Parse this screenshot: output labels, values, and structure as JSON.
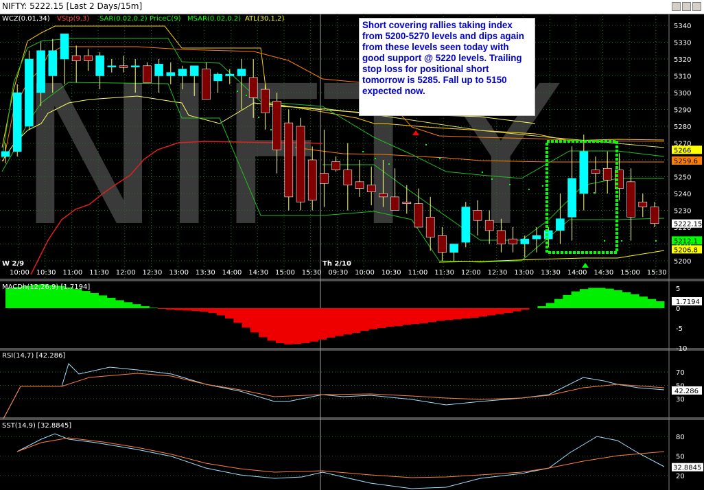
{
  "window": {
    "title": "NIFTY:  5222.15 [Last 2 Days/15m]"
  },
  "watermark": "NIFTY",
  "main_legend": [
    {
      "text": "WCZ(0.01,34)",
      "color": "#ffffff"
    },
    {
      "text": "VStp(9,3)",
      "color": "#ff4040"
    },
    {
      "text": "SAR(0.02,0.2)",
      "color": "#00ff00"
    },
    {
      "text": "PriceC(9)",
      "color": "#00ff00"
    },
    {
      "text": "MSAR(0.02,0.2)",
      "color": "#00ff00"
    },
    {
      "text": "ATL(30,1,2)",
      "color": "#ffff00"
    }
  ],
  "annotation": "Short covering rallies taking index from 5200-5270 levels and dips again from these levels seen today with good support @ 5220 levels. Trailing stop loss for positional short tomorrow is 5285. Fall up to 5150 expected now.",
  "price_axis": [
    "5340",
    "5330",
    "5320",
    "5310",
    "5300",
    "5290",
    "5280",
    "5270",
    "5260",
    "5250",
    "5240",
    "5230",
    "5220",
    "5210",
    "5200"
  ],
  "price_tags": [
    {
      "text": "5266",
      "bg": "#ffff00",
      "fg": "#000000"
    },
    {
      "text": "5259.6",
      "bg": "#ff8000",
      "fg": "#000000"
    },
    {
      "text": "5222.15",
      "bg": "#ffffff",
      "fg": "#000000"
    },
    {
      "text": "5212.1",
      "bg": "#00ff00",
      "fg": "#000000"
    },
    {
      "text": "5206.8",
      "bg": "#ffff00",
      "fg": "#000000"
    }
  ],
  "time_axis": [
    "10:00",
    "10:30",
    "11:00",
    "11:30",
    "12:00",
    "12:30",
    "13:00",
    "13:30",
    "14:00",
    "14:30",
    "15:00",
    "15:30",
    "09:30",
    "10:00",
    "10:30",
    "11:00",
    "11:30",
    "12:00",
    "12:30",
    "13:00",
    "13:30",
    "14:00",
    "14:30",
    "15:00",
    "15:30"
  ],
  "day_labels": [
    {
      "text": "W  2/9"
    },
    {
      "text": "Th 2/10"
    }
  ],
  "macd": {
    "label": "MACDh(12,26,9) [1.7194]",
    "axis": [
      "5",
      "0",
      "-5",
      "-10"
    ],
    "tag": "1.7194"
  },
  "rsi": {
    "label": "RSI(14,7) [42.286]",
    "axis": [
      "70",
      "50",
      "30"
    ],
    "tag": "42.286"
  },
  "sst": {
    "label": "SST(14,9) [32.8845]",
    "axis": [
      "80",
      "50",
      "20"
    ],
    "tag": "32.8845"
  },
  "chart_data": {
    "type": "candlestick",
    "price_ylim": [
      5200,
      5340
    ],
    "candles": [
      {
        "o": 5262,
        "h": 5270,
        "l": 5258,
        "c": 5265
      },
      {
        "o": 5265,
        "h": 5305,
        "l": 5262,
        "c": 5300
      },
      {
        "o": 5280,
        "h": 5325,
        "l": 5278,
        "c": 5320
      },
      {
        "o": 5300,
        "h": 5330,
        "l": 5292,
        "c": 5325
      },
      {
        "o": 5310,
        "h": 5332,
        "l": 5300,
        "c": 5325
      },
      {
        "o": 5320,
        "h": 5335,
        "l": 5305,
        "c": 5335
      },
      {
        "o": 5322,
        "h": 5328,
        "l": 5306,
        "c": 5319
      },
      {
        "o": 5322,
        "h": 5326,
        "l": 5313,
        "c": 5319
      },
      {
        "o": 5310,
        "h": 5324,
        "l": 5302,
        "c": 5322
      },
      {
        "o": 5316,
        "h": 5320,
        "l": 5312,
        "c": 5316
      },
      {
        "o": 5316,
        "h": 5322,
        "l": 5312,
        "c": 5315
      },
      {
        "o": 5316,
        "h": 5320,
        "l": 5300,
        "c": 5316
      },
      {
        "o": 5316,
        "h": 5318,
        "l": 5306,
        "c": 5306
      },
      {
        "o": 5310,
        "h": 5320,
        "l": 5300,
        "c": 5317
      },
      {
        "o": 5310,
        "h": 5318,
        "l": 5305,
        "c": 5312
      },
      {
        "o": 5310,
        "h": 5316,
        "l": 5302,
        "c": 5314
      },
      {
        "o": 5310,
        "h": 5315,
        "l": 5298,
        "c": 5316
      },
      {
        "o": 5314,
        "h": 5318,
        "l": 5296,
        "c": 5296
      },
      {
        "o": 5307,
        "h": 5312,
        "l": 5300,
        "c": 5311
      },
      {
        "o": 5310,
        "h": 5314,
        "l": 5305,
        "c": 5311
      },
      {
        "o": 5310,
        "h": 5320,
        "l": 5290,
        "c": 5314
      },
      {
        "o": 5309,
        "h": 5320,
        "l": 5285,
        "c": 5297
      },
      {
        "o": 5302,
        "h": 5305,
        "l": 5278,
        "c": 5288
      },
      {
        "o": 5295,
        "h": 5300,
        "l": 5252,
        "c": 5266
      },
      {
        "o": 5282,
        "h": 5290,
        "l": 5230,
        "c": 5238
      },
      {
        "o": 5280,
        "h": 5285,
        "l": 5230,
        "c": 5235
      },
      {
        "o": 5260,
        "h": 5268,
        "l": 5230,
        "c": 5236
      },
      {
        "o": 5252,
        "h": 5278,
        "l": 5232,
        "c": 5246
      },
      {
        "o": 5259,
        "h": 5262,
        "l": 5253,
        "c": 5254
      },
      {
        "o": 5254,
        "h": 5270,
        "l": 5230,
        "c": 5245
      },
      {
        "o": 5247,
        "h": 5260,
        "l": 5238,
        "c": 5243
      },
      {
        "o": 5245,
        "h": 5256,
        "l": 5233,
        "c": 5241
      },
      {
        "o": 5240,
        "h": 5260,
        "l": 5232,
        "c": 5238
      },
      {
        "o": 5238,
        "h": 5255,
        "l": 5230,
        "c": 5230
      },
      {
        "o": 5235,
        "h": 5245,
        "l": 5228,
        "c": 5234
      },
      {
        "o": 5234,
        "h": 5243,
        "l": 5220,
        "c": 5220
      },
      {
        "o": 5226,
        "h": 5238,
        "l": 5206,
        "c": 5214
      },
      {
        "o": 5215,
        "h": 5220,
        "l": 5200,
        "c": 5205
      },
      {
        "o": 5205,
        "h": 5210,
        "l": 5200,
        "c": 5210
      },
      {
        "o": 5211,
        "h": 5235,
        "l": 5208,
        "c": 5232
      },
      {
        "o": 5230,
        "h": 5236,
        "l": 5215,
        "c": 5224
      },
      {
        "o": 5224,
        "h": 5230,
        "l": 5210,
        "c": 5218
      },
      {
        "o": 5218,
        "h": 5225,
        "l": 5205,
        "c": 5210
      },
      {
        "o": 5213,
        "h": 5220,
        "l": 5205,
        "c": 5210
      },
      {
        "o": 5210,
        "h": 5215,
        "l": 5202,
        "c": 5213
      },
      {
        "o": 5213,
        "h": 5220,
        "l": 5205,
        "c": 5215
      },
      {
        "o": 5213,
        "h": 5220,
        "l": 5208,
        "c": 5218
      },
      {
        "o": 5218,
        "h": 5240,
        "l": 5210,
        "c": 5225
      },
      {
        "o": 5226,
        "h": 5268,
        "l": 5212,
        "c": 5249
      },
      {
        "o": 5240,
        "h": 5275,
        "l": 5230,
        "c": 5265
      },
      {
        "o": 5254,
        "h": 5262,
        "l": 5240,
        "c": 5252
      },
      {
        "o": 5255,
        "h": 5265,
        "l": 5240,
        "c": 5248
      },
      {
        "o": 5254,
        "h": 5264,
        "l": 5236,
        "c": 5243
      },
      {
        "o": 5247,
        "h": 5255,
        "l": 5212,
        "c": 5226
      },
      {
        "o": 5235,
        "h": 5240,
        "l": 5226,
        "c": 5232
      },
      {
        "o": 5232,
        "h": 5235,
        "l": 5220,
        "c": 5222.15
      }
    ],
    "macd_hist": [
      5,
      5.3,
      5.6,
      5.9,
      6.0,
      5.8,
      5.6,
      5.2,
      4.8,
      4.3,
      3.8,
      3.2,
      2.6,
      2.0,
      1.5,
      1.0,
      0.5,
      0.1,
      -0.2,
      -0.4,
      -0.5,
      -0.6,
      -0.7,
      -0.9,
      -1.2,
      -1.8,
      -2.6,
      -3.7,
      -4.9,
      -6.1,
      -7.3,
      -8.2,
      -8.8,
      -9.1,
      -9.0,
      -8.8,
      -8.4,
      -7.9,
      -7.4,
      -7.0,
      -6.6,
      -6.2,
      -5.7,
      -5.3,
      -5.0,
      -4.7,
      -4.5,
      -4.2,
      -4.0,
      -3.8,
      -3.5,
      -3.2,
      -3.0,
      -2.8,
      -2.6,
      -2.4,
      -2.1,
      -1.8,
      -1.5,
      -1.2,
      -0.8,
      -0.4,
      0.0,
      0.5,
      1.3,
      2.3,
      3.3,
      4.2,
      4.8,
      5.1,
      5.1,
      4.9,
      4.5,
      4.0,
      3.5,
      2.9,
      2.3,
      1.7194
    ],
    "macd_ylim": [
      -10,
      5
    ]
  }
}
